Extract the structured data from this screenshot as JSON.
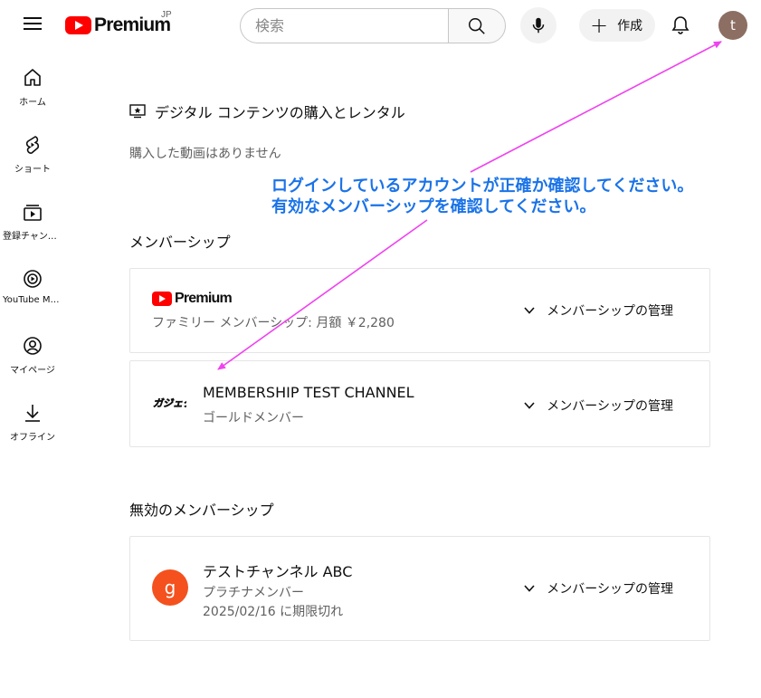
{
  "header": {
    "logo_text": "Premium",
    "logo_country": "JP",
    "search_placeholder": "検索",
    "create_label": "作成",
    "avatar_letter": "t"
  },
  "sidebar": {
    "items": [
      {
        "label": "ホーム",
        "icon": "home-icon"
      },
      {
        "label": "ショート",
        "icon": "shorts-icon"
      },
      {
        "label": "登録チャンネル",
        "icon": "subscriptions-icon"
      },
      {
        "label": "YouTube Music",
        "icon": "youtube-music-icon"
      },
      {
        "label": "マイページ",
        "icon": "my-page-icon"
      },
      {
        "label": "オフライン",
        "icon": "download-icon"
      }
    ]
  },
  "main": {
    "digital_title": "デジタル コンテンツの購入とレンタル",
    "no_videos": "購入した動画はありません",
    "memberships_title": "メンバーシップ",
    "inactive_title": "無効のメンバーシップ",
    "memberships": [
      {
        "logo_text": "Premium",
        "subtitle": "ファミリー メンバーシップ: 月額 ￥2,280",
        "manage_label": "メンバーシップの管理"
      },
      {
        "title": "MEMBERSHIP TEST CHANNEL",
        "logo_text": "ガジェタブ",
        "subtitle": "ゴールドメンバー",
        "manage_label": "メンバーシップの管理"
      }
    ],
    "inactive_memberships": [
      {
        "title": "テストチャンネル ABC",
        "avatar_letter": "g",
        "subtitle": "プラチナメンバー",
        "expiry": "2025/02/16 に期限切れ",
        "manage_label": "メンバーシップの管理"
      }
    ]
  },
  "annotation": {
    "line1": "ログインしているアカウントが正確か確認してください。",
    "line2": "有効なメンバーシップを確認してください。",
    "color": "#1a73e8",
    "arrow_color": "#ee44ee"
  }
}
